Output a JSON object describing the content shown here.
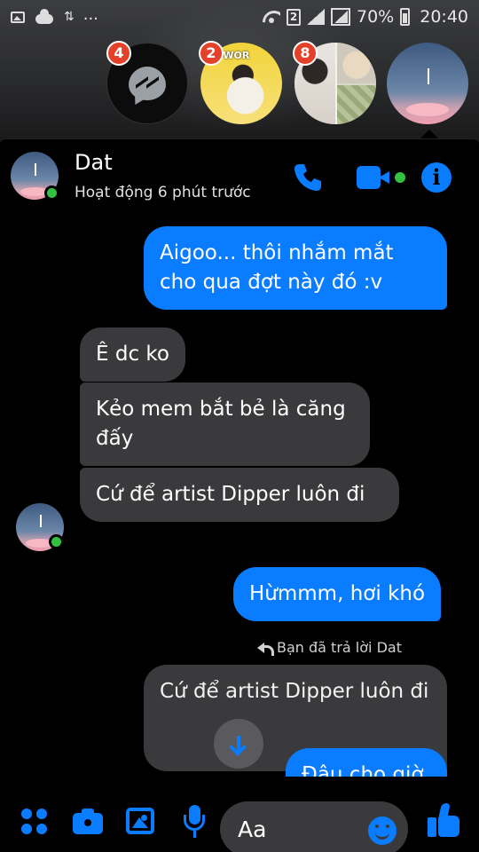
{
  "status_bar": {
    "sim_slot": "2",
    "battery_percent": "70%",
    "time": "20:40",
    "icons": [
      "gallery-icon",
      "cloud-icon",
      "data-transfer-icon",
      "more-dots-icon",
      "wifi-icon",
      "sim-icon",
      "signal-icon",
      "signal-full-icon",
      "battery-icon"
    ],
    "more": "..."
  },
  "chat_heads": [
    {
      "kind": "messenger",
      "badge": "4"
    },
    {
      "kind": "contact",
      "badge": "2",
      "watermark": "PE WOR"
    },
    {
      "kind": "contact",
      "badge": "8"
    },
    {
      "kind": "contact-active",
      "badge": ""
    }
  ],
  "conversation": {
    "contact_name": "Dat",
    "contact_status": "Hoạt động 6 phút trước",
    "online": true
  },
  "header_actions": [
    "phone-icon",
    "video-icon",
    "info-icon"
  ],
  "messages": [
    {
      "direction": "out",
      "text": "Aigoo... thôi nhắm mắt cho qua đợt này đó :v"
    },
    {
      "direction": "in",
      "text": "Ê dc ko"
    },
    {
      "direction": "in",
      "text": "Kẻo mem bắt bẻ là căng đấy"
    },
    {
      "direction": "in",
      "text": "Cứ để artist Dipper luôn đi"
    },
    {
      "direction": "out",
      "text": "Hừmmm, hơi khó"
    }
  ],
  "reply": {
    "hint": "Bạn đã trả lời Dat",
    "quoted_text": "Cứ để artist Dipper luôn đi",
    "partial_text": "Đâu cho giờ"
  },
  "composer": {
    "placeholder": "Aa",
    "actions": [
      "more-grid-icon",
      "camera-icon",
      "image-icon",
      "microphone-icon",
      "emoji-icon",
      "like-icon"
    ]
  },
  "colors": {
    "accent": "#0a7cff",
    "incoming_bubble": "#3a3a3c",
    "background": "#000000",
    "online": "#33c13f",
    "badge": "#e4412a"
  }
}
